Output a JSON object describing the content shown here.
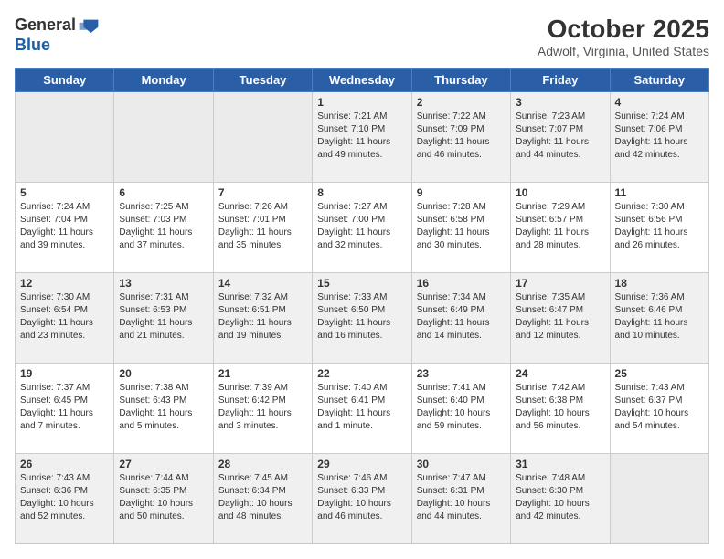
{
  "header": {
    "logo_general": "General",
    "logo_blue": "Blue",
    "month_title": "October 2025",
    "location": "Adwolf, Virginia, United States"
  },
  "weekdays": [
    "Sunday",
    "Monday",
    "Tuesday",
    "Wednesday",
    "Thursday",
    "Friday",
    "Saturday"
  ],
  "weeks": [
    [
      {
        "day": "",
        "info": ""
      },
      {
        "day": "",
        "info": ""
      },
      {
        "day": "",
        "info": ""
      },
      {
        "day": "1",
        "info": "Sunrise: 7:21 AM\nSunset: 7:10 PM\nDaylight: 11 hours\nand 49 minutes."
      },
      {
        "day": "2",
        "info": "Sunrise: 7:22 AM\nSunset: 7:09 PM\nDaylight: 11 hours\nand 46 minutes."
      },
      {
        "day": "3",
        "info": "Sunrise: 7:23 AM\nSunset: 7:07 PM\nDaylight: 11 hours\nand 44 minutes."
      },
      {
        "day": "4",
        "info": "Sunrise: 7:24 AM\nSunset: 7:06 PM\nDaylight: 11 hours\nand 42 minutes."
      }
    ],
    [
      {
        "day": "5",
        "info": "Sunrise: 7:24 AM\nSunset: 7:04 PM\nDaylight: 11 hours\nand 39 minutes."
      },
      {
        "day": "6",
        "info": "Sunrise: 7:25 AM\nSunset: 7:03 PM\nDaylight: 11 hours\nand 37 minutes."
      },
      {
        "day": "7",
        "info": "Sunrise: 7:26 AM\nSunset: 7:01 PM\nDaylight: 11 hours\nand 35 minutes."
      },
      {
        "day": "8",
        "info": "Sunrise: 7:27 AM\nSunset: 7:00 PM\nDaylight: 11 hours\nand 32 minutes."
      },
      {
        "day": "9",
        "info": "Sunrise: 7:28 AM\nSunset: 6:58 PM\nDaylight: 11 hours\nand 30 minutes."
      },
      {
        "day": "10",
        "info": "Sunrise: 7:29 AM\nSunset: 6:57 PM\nDaylight: 11 hours\nand 28 minutes."
      },
      {
        "day": "11",
        "info": "Sunrise: 7:30 AM\nSunset: 6:56 PM\nDaylight: 11 hours\nand 26 minutes."
      }
    ],
    [
      {
        "day": "12",
        "info": "Sunrise: 7:30 AM\nSunset: 6:54 PM\nDaylight: 11 hours\nand 23 minutes."
      },
      {
        "day": "13",
        "info": "Sunrise: 7:31 AM\nSunset: 6:53 PM\nDaylight: 11 hours\nand 21 minutes."
      },
      {
        "day": "14",
        "info": "Sunrise: 7:32 AM\nSunset: 6:51 PM\nDaylight: 11 hours\nand 19 minutes."
      },
      {
        "day": "15",
        "info": "Sunrise: 7:33 AM\nSunset: 6:50 PM\nDaylight: 11 hours\nand 16 minutes."
      },
      {
        "day": "16",
        "info": "Sunrise: 7:34 AM\nSunset: 6:49 PM\nDaylight: 11 hours\nand 14 minutes."
      },
      {
        "day": "17",
        "info": "Sunrise: 7:35 AM\nSunset: 6:47 PM\nDaylight: 11 hours\nand 12 minutes."
      },
      {
        "day": "18",
        "info": "Sunrise: 7:36 AM\nSunset: 6:46 PM\nDaylight: 11 hours\nand 10 minutes."
      }
    ],
    [
      {
        "day": "19",
        "info": "Sunrise: 7:37 AM\nSunset: 6:45 PM\nDaylight: 11 hours\nand 7 minutes."
      },
      {
        "day": "20",
        "info": "Sunrise: 7:38 AM\nSunset: 6:43 PM\nDaylight: 11 hours\nand 5 minutes."
      },
      {
        "day": "21",
        "info": "Sunrise: 7:39 AM\nSunset: 6:42 PM\nDaylight: 11 hours\nand 3 minutes."
      },
      {
        "day": "22",
        "info": "Sunrise: 7:40 AM\nSunset: 6:41 PM\nDaylight: 11 hours\nand 1 minute."
      },
      {
        "day": "23",
        "info": "Sunrise: 7:41 AM\nSunset: 6:40 PM\nDaylight: 10 hours\nand 59 minutes."
      },
      {
        "day": "24",
        "info": "Sunrise: 7:42 AM\nSunset: 6:38 PM\nDaylight: 10 hours\nand 56 minutes."
      },
      {
        "day": "25",
        "info": "Sunrise: 7:43 AM\nSunset: 6:37 PM\nDaylight: 10 hours\nand 54 minutes."
      }
    ],
    [
      {
        "day": "26",
        "info": "Sunrise: 7:43 AM\nSunset: 6:36 PM\nDaylight: 10 hours\nand 52 minutes."
      },
      {
        "day": "27",
        "info": "Sunrise: 7:44 AM\nSunset: 6:35 PM\nDaylight: 10 hours\nand 50 minutes."
      },
      {
        "day": "28",
        "info": "Sunrise: 7:45 AM\nSunset: 6:34 PM\nDaylight: 10 hours\nand 48 minutes."
      },
      {
        "day": "29",
        "info": "Sunrise: 7:46 AM\nSunset: 6:33 PM\nDaylight: 10 hours\nand 46 minutes."
      },
      {
        "day": "30",
        "info": "Sunrise: 7:47 AM\nSunset: 6:31 PM\nDaylight: 10 hours\nand 44 minutes."
      },
      {
        "day": "31",
        "info": "Sunrise: 7:48 AM\nSunset: 6:30 PM\nDaylight: 10 hours\nand 42 minutes."
      },
      {
        "day": "",
        "info": ""
      }
    ]
  ]
}
